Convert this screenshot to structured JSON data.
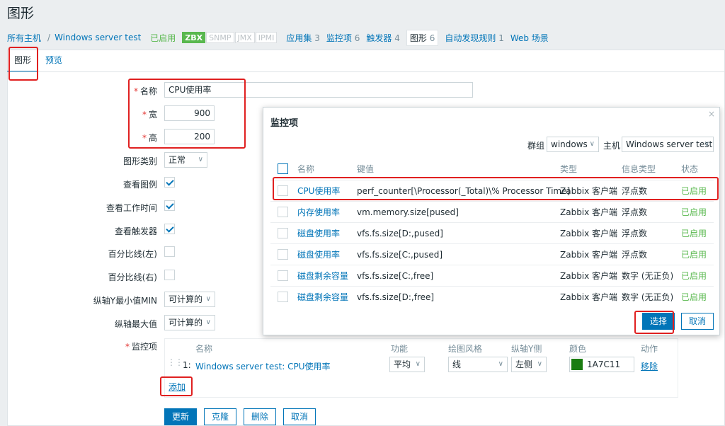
{
  "page_title": "图形",
  "breadcrumb": {
    "all_hosts": "所有主机",
    "separator": "/",
    "host": "Windows server test",
    "status": "已启用",
    "badges": [
      "ZBX",
      "SNMP",
      "JMX",
      "IPMI"
    ],
    "links": [
      {
        "label": "应用集",
        "count": "3"
      },
      {
        "label": "监控项",
        "count": "6"
      },
      {
        "label": "触发器",
        "count": "4"
      },
      {
        "label": "图形",
        "count": "6"
      },
      {
        "label": "自动发现规则",
        "count": "1"
      },
      {
        "label": "Web 场景",
        "count": ""
      }
    ]
  },
  "tabs": [
    "图形",
    "预览"
  ],
  "form": {
    "name_label": "名称",
    "name_value": "CPU使用率",
    "width_label": "宽",
    "width_value": "900",
    "height_label": "高",
    "height_value": "200",
    "graph_type_label": "图形类别",
    "graph_type_value": "正常",
    "show_legend_label": "查看图例",
    "show_worktime_label": "查看工作时间",
    "show_triggers_label": "查看触发器",
    "percentile_left_label": "百分比线(左)",
    "percentile_right_label": "百分比线(右)",
    "ymin_label": "纵轴Y最小值MIN",
    "ymin_value": "可计算的",
    "ymax_label": "纵轴最大值",
    "ymax_value": "可计算的",
    "items_label": "监控项"
  },
  "items_table": {
    "headers": [
      "名称",
      "功能",
      "绘图风格",
      "纵轴Y侧",
      "颜色",
      "动作"
    ],
    "rows": [
      {
        "index": "1:",
        "name": "Windows server test: CPU使用率",
        "function": "平均",
        "style": "线",
        "yaxis": "左侧",
        "color_hex": "#1A7C11",
        "color_text": "1A7C11",
        "action": "移除"
      }
    ],
    "add_label": "添加"
  },
  "buttons": {
    "update": "更新",
    "clone": "克隆",
    "delete": "删除",
    "cancel": "取消"
  },
  "modal": {
    "title": "监控项",
    "close": "×",
    "group_label": "群组",
    "group_value": "windows",
    "host_label": "主机",
    "host_value": "Windows server test",
    "headers": [
      "名称",
      "键值",
      "类型",
      "信息类型",
      "状态"
    ],
    "rows": [
      {
        "name": "CPU使用率",
        "key": "perf_counter[\\Processor(_Total)\\% Processor Time]",
        "type": "Zabbix 客户端",
        "info": "浮点数",
        "status": "已启用"
      },
      {
        "name": "内存使用率",
        "key": "vm.memory.size[pused]",
        "type": "Zabbix 客户端",
        "info": "浮点数",
        "status": "已启用"
      },
      {
        "name": "磁盘使用率",
        "key": "vfs.fs.size[D:,pused]",
        "type": "Zabbix 客户端",
        "info": "浮点数",
        "status": "已启用"
      },
      {
        "name": "磁盘使用率",
        "key": "vfs.fs.size[C:,pused]",
        "type": "Zabbix 客户端",
        "info": "浮点数",
        "status": "已启用"
      },
      {
        "name": "磁盘剩余容量",
        "key": "vfs.fs.size[C:,free]",
        "type": "Zabbix 客户端",
        "info": "数字 (无正负)",
        "status": "已启用"
      },
      {
        "name": "磁盘剩余容量",
        "key": "vfs.fs.size[D:,free]",
        "type": "Zabbix 客户端",
        "info": "数字 (无正负)",
        "status": "已启用"
      }
    ],
    "select_button": "选择",
    "cancel_button": "取消"
  }
}
